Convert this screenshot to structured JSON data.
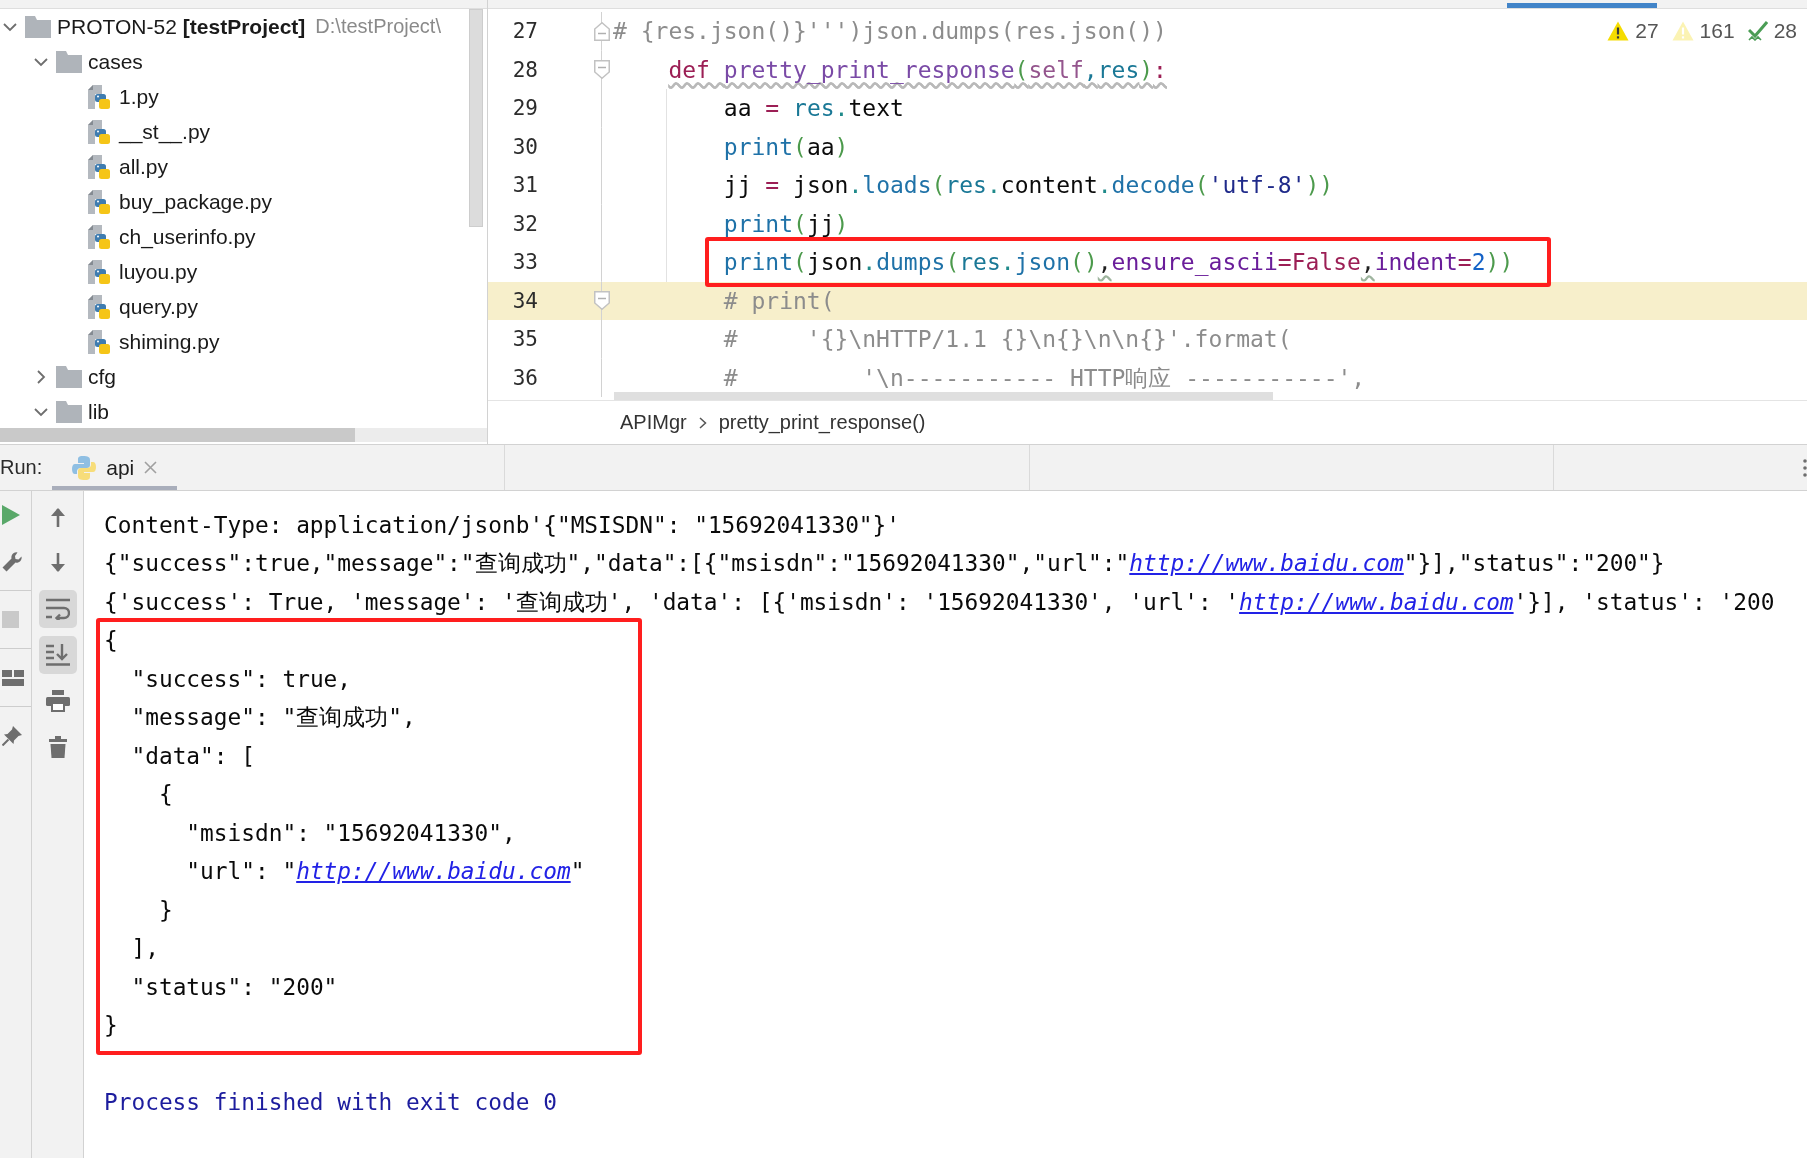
{
  "project_tree": {
    "root": {
      "kind": "project",
      "name": "PROTON-52",
      "module": "[testProject]",
      "path": "D:\\testProject\\",
      "expanded": true,
      "children": [
        {
          "kind": "folder",
          "name": "cases",
          "expanded": true,
          "children": [
            {
              "kind": "python_file",
              "name": "1.py"
            },
            {
              "kind": "python_file",
              "name": "__st__.py"
            },
            {
              "kind": "python_file",
              "name": "all.py"
            },
            {
              "kind": "python_file",
              "name": "buy_package.py"
            },
            {
              "kind": "python_file",
              "name": "ch_userinfo.py"
            },
            {
              "kind": "python_file",
              "name": "luyou.py"
            },
            {
              "kind": "python_file",
              "name": "query.py"
            },
            {
              "kind": "python_file",
              "name": "shiming.py"
            }
          ]
        },
        {
          "kind": "folder",
          "name": "cfg",
          "expanded": false
        },
        {
          "kind": "folder",
          "name": "lib",
          "expanded": true
        }
      ]
    }
  },
  "editor": {
    "inspections": [
      {
        "kind": "warning",
        "count": "27"
      },
      {
        "kind": "weak_warning",
        "count": "161"
      },
      {
        "kind": "typo",
        "count": "28"
      }
    ],
    "lines": [
      {
        "number": "27",
        "current": false,
        "annotated": false,
        "warning": false,
        "fold_start": false,
        "fold_end": true,
        "tokens": [
          {
            "kind": "comment",
            "text": "# {res.json()}''')json.dumps(res.json())"
          }
        ]
      },
      {
        "number": "28",
        "current": false,
        "annotated": false,
        "warning": true,
        "fold_start": true,
        "fold_end": false,
        "tokens": [
          {
            "kind": "keyword",
            "text": "    def "
          },
          {
            "kind": "funcname",
            "text": "pretty_print_response"
          },
          {
            "kind": "paren",
            "text": "("
          },
          {
            "kind": "self",
            "text": "self"
          },
          {
            "kind": "punct",
            "text": ","
          },
          {
            "kind": "param",
            "text": "res"
          },
          {
            "kind": "paren",
            "text": ")"
          },
          {
            "kind": "keyword",
            "text": ":"
          }
        ]
      },
      {
        "number": "29",
        "current": false,
        "annotated": false,
        "warning": false,
        "fold_start": false,
        "fold_end": false,
        "tokens": [
          {
            "kind": "ident",
            "text": "        aa "
          },
          {
            "kind": "op",
            "text": "= "
          },
          {
            "kind": "param",
            "text": "res"
          },
          {
            "kind": "dot",
            "text": "."
          },
          {
            "kind": "ident",
            "text": "text"
          }
        ]
      },
      {
        "number": "30",
        "current": false,
        "annotated": false,
        "warning": false,
        "fold_start": false,
        "fold_end": false,
        "tokens": [
          {
            "kind": "builtin",
            "text": "        print"
          },
          {
            "kind": "paren",
            "text": "("
          },
          {
            "kind": "ident",
            "text": "aa"
          },
          {
            "kind": "paren",
            "text": ")"
          }
        ]
      },
      {
        "number": "31",
        "current": false,
        "annotated": false,
        "warning": false,
        "fold_start": false,
        "fold_end": false,
        "tokens": [
          {
            "kind": "ident",
            "text": "        jj "
          },
          {
            "kind": "op",
            "text": "= "
          },
          {
            "kind": "ident",
            "text": "json"
          },
          {
            "kind": "dot",
            "text": "."
          },
          {
            "kind": "method",
            "text": "loads"
          },
          {
            "kind": "paren",
            "text": "("
          },
          {
            "kind": "param",
            "text": "res"
          },
          {
            "kind": "dot",
            "text": "."
          },
          {
            "kind": "ident",
            "text": "content"
          },
          {
            "kind": "dot",
            "text": "."
          },
          {
            "kind": "method",
            "text": "decode"
          },
          {
            "kind": "paren",
            "text": "("
          },
          {
            "kind": "string",
            "text": "'utf-8'"
          },
          {
            "kind": "paren",
            "text": "))"
          }
        ]
      },
      {
        "number": "32",
        "current": false,
        "annotated": false,
        "warning": false,
        "fold_start": false,
        "fold_end": false,
        "tokens": [
          {
            "kind": "builtin",
            "text": "        print"
          },
          {
            "kind": "paren",
            "text": "("
          },
          {
            "kind": "ident",
            "text": "jj"
          },
          {
            "kind": "paren",
            "text": ")"
          }
        ]
      },
      {
        "number": "33",
        "current": false,
        "annotated": true,
        "warning": false,
        "fold_start": false,
        "fold_end": false,
        "tokens": [
          {
            "kind": "builtin",
            "text": "        print"
          },
          {
            "kind": "paren",
            "text": "("
          },
          {
            "kind": "ident",
            "text": "json"
          },
          {
            "kind": "dot",
            "text": "."
          },
          {
            "kind": "method",
            "text": "dumps"
          },
          {
            "kind": "paren",
            "text": "("
          },
          {
            "kind": "param",
            "text": "res"
          },
          {
            "kind": "dot",
            "text": "."
          },
          {
            "kind": "method",
            "text": "json"
          },
          {
            "kind": "paren",
            "text": "()"
          },
          {
            "kind": "flagged",
            "text": ","
          },
          {
            "kind": "kwarg",
            "text": "ensure_ascii"
          },
          {
            "kind": "op",
            "text": "="
          },
          {
            "kind": "constant",
            "text": "False"
          },
          {
            "kind": "flagged",
            "text": ","
          },
          {
            "kind": "kwarg",
            "text": "indent"
          },
          {
            "kind": "op",
            "text": "="
          },
          {
            "kind": "number",
            "text": "2"
          },
          {
            "kind": "paren",
            "text": "))"
          }
        ]
      },
      {
        "number": "34",
        "current": true,
        "annotated": false,
        "warning": false,
        "fold_start": true,
        "fold_end": false,
        "tokens": [
          {
            "kind": "comment",
            "text": "        # print("
          }
        ]
      },
      {
        "number": "35",
        "current": false,
        "annotated": false,
        "warning": false,
        "fold_start": false,
        "fold_end": false,
        "tokens": [
          {
            "kind": "comment",
            "text": "        #     '{}\\nHTTP/1.1 {}\\n{}\\n\\n{}'.format("
          }
        ]
      },
      {
        "number": "36",
        "current": false,
        "annotated": false,
        "warning": false,
        "fold_start": false,
        "fold_end": false,
        "tokens": [
          {
            "kind": "comment",
            "text": "        #         '\\n----------- HTTP响应 -----------',"
          }
        ]
      }
    ],
    "breadcrumb": [
      "APIMgr",
      "pretty_print_response()"
    ]
  },
  "run_window": {
    "label": "Run:",
    "tabs": [
      {
        "label": "api",
        "selected": true
      }
    ],
    "side_toolbar": [
      {
        "items": [
          {
            "kind": "run",
            "disabled": false
          },
          {
            "kind": "wrench",
            "disabled": false
          }
        ]
      },
      {
        "items": [
          {
            "kind": "stop",
            "disabled": true
          }
        ]
      },
      {
        "items": [
          {
            "kind": "layout",
            "disabled": false
          }
        ]
      },
      {
        "items": [
          {
            "kind": "pin",
            "disabled": false
          }
        ]
      }
    ],
    "console_toolbar": [
      {
        "kind": "up",
        "selected": false
      },
      {
        "kind": "down",
        "selected": false
      },
      {
        "kind": "soft_wrap",
        "selected": true
      },
      {
        "kind": "scroll_to_end",
        "selected": true
      },
      {
        "kind": "print",
        "selected": false
      },
      {
        "kind": "clear",
        "selected": false
      }
    ],
    "console": {
      "blocks": [
        {
          "kind": "output",
          "lines": [
            {
              "parts": [
                {
                  "kind": "text",
                  "text": "Content-Type: application/jsonb'{\"MSISDN\": \"15692041330\"}'"
                }
              ]
            },
            {
              "parts": [
                {
                  "kind": "text",
                  "text": "{\"success\":true,\"message\":\"查询成功\",\"data\":[{\"msisdn\":\"15692041330\",\"url\":\""
                },
                {
                  "kind": "link",
                  "text": "http://www.baidu.com"
                },
                {
                  "kind": "text",
                  "text": "\"}],\"status\":\"200\"}"
                }
              ]
            },
            {
              "parts": [
                {
                  "kind": "text",
                  "text": "{'success': True, 'message': '查询成功', 'data': [{'msisdn': '15692041330', 'url': '"
                },
                {
                  "kind": "link",
                  "text": "http://www.baidu.com"
                },
                {
                  "kind": "text",
                  "text": "'}], 'status': '200"
                }
              ]
            }
          ]
        },
        {
          "kind": "annotated",
          "lines": [
            {
              "parts": [
                {
                  "kind": "text",
                  "text": "{"
                }
              ]
            },
            {
              "parts": [
                {
                  "kind": "text",
                  "text": "  \"success\": true,"
                }
              ]
            },
            {
              "parts": [
                {
                  "kind": "text",
                  "text": "  \"message\": \"查询成功\","
                }
              ]
            },
            {
              "parts": [
                {
                  "kind": "text",
                  "text": "  \"data\": ["
                }
              ]
            },
            {
              "parts": [
                {
                  "kind": "text",
                  "text": "    {"
                }
              ]
            },
            {
              "parts": [
                {
                  "kind": "text",
                  "text": "      \"msisdn\": \"15692041330\","
                }
              ]
            },
            {
              "parts": [
                {
                  "kind": "text",
                  "text": "      \"url\": \""
                },
                {
                  "kind": "link",
                  "text": "http://www.baidu.com"
                },
                {
                  "kind": "text",
                  "text": "\""
                }
              ]
            },
            {
              "parts": [
                {
                  "kind": "text",
                  "text": "    }"
                }
              ]
            },
            {
              "parts": [
                {
                  "kind": "text",
                  "text": "  ],"
                }
              ]
            },
            {
              "parts": [
                {
                  "kind": "text",
                  "text": "  \"status\": \"200\""
                }
              ]
            },
            {
              "parts": [
                {
                  "kind": "text",
                  "text": "}"
                }
              ]
            }
          ]
        },
        {
          "kind": "system",
          "lines": [
            {
              "parts": [
                {
                  "kind": "text",
                  "text": "Process finished with exit code 0"
                }
              ]
            }
          ]
        }
      ]
    }
  }
}
